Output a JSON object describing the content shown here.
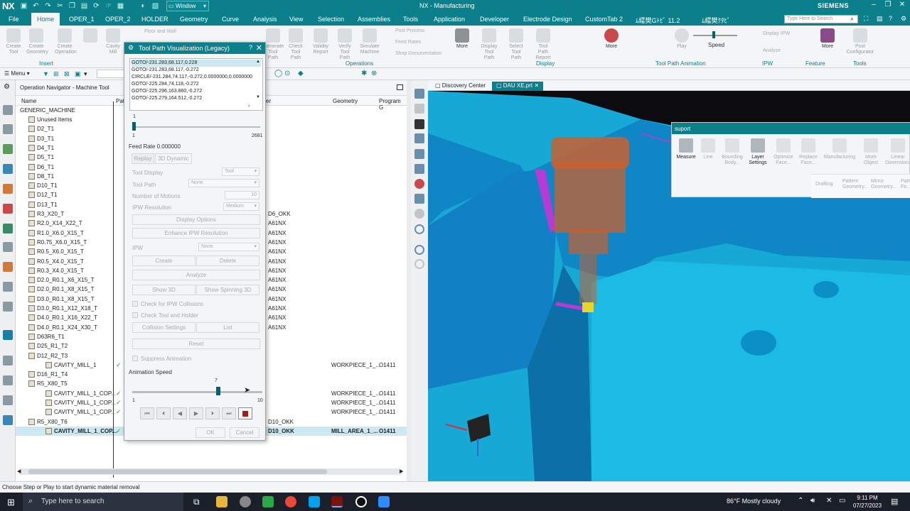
{
  "titlebar": {
    "logo": "NX",
    "window_menu": "Window",
    "app_title": "NX - Manufacturing",
    "brand": "SIEMENS"
  },
  "menubar": {
    "items": [
      "File",
      "Home",
      "OPER_1",
      "OPER_2",
      "HOLDER",
      "Geometry",
      "Curve",
      "Analysis",
      "View",
      "Selection",
      "Assemblies",
      "Tools",
      "Application",
      "Developer",
      "Electrode Design",
      "CustomTab 2",
      "ﾑ繧樊Gﾄﾋﾟ 11.2",
      "ﾑ繧樊ｸﾀﾋﾟ"
    ],
    "active": "Home",
    "search_placeholder": "Type Here to Search"
  },
  "ribbon": {
    "buttons": [
      "Create Tool",
      "Create Geometry",
      "Create Operation",
      "Cavity Mill",
      "Floor and Wall",
      "Generate Tool Path",
      "Check Tool Path",
      "Validity Report",
      "Verify Tool Path",
      "Simulate Machine",
      "Post Process",
      "Feed Rates",
      "Shop Documentation",
      "More",
      "Display Tool Path",
      "Select Tool Path",
      "Tool Path Report",
      "More",
      "Play",
      "Speed",
      "Display IPW",
      "Analyze",
      "More",
      "Post Configurator"
    ],
    "groups": [
      "Insert",
      "Operations",
      "Display",
      "Tool Path Animation",
      "IPW",
      "Feature",
      "Tools"
    ]
  },
  "toolbar2": {
    "menu_label": "Menu"
  },
  "navigator": {
    "title": "Operation Navigator - Machine Tool",
    "columns": [
      "Name",
      "Pat",
      "er",
      "Geometry",
      "Program G"
    ],
    "root": "GENERIC_MACHINE",
    "rows": [
      {
        "name": "Unused Items",
        "path": "",
        "geo": "",
        "prog": ""
      },
      {
        "name": "D2_T1",
        "path": "",
        "geo": "",
        "prog": ""
      },
      {
        "name": "D3_T1",
        "path": "",
        "geo": "",
        "prog": ""
      },
      {
        "name": "D4_T1",
        "path": "",
        "geo": "",
        "prog": ""
      },
      {
        "name": "D5_T1",
        "path": "",
        "geo": "",
        "prog": ""
      },
      {
        "name": "D6_T1",
        "path": "",
        "geo": "",
        "prog": ""
      },
      {
        "name": "D8_T1",
        "path": "",
        "geo": "",
        "prog": ""
      },
      {
        "name": "D10_T1",
        "path": "",
        "geo": "",
        "prog": ""
      },
      {
        "name": "D12_T1",
        "path": "",
        "geo": "",
        "prog": ""
      },
      {
        "name": "D13_T1",
        "path": "",
        "geo": "",
        "prog": ""
      },
      {
        "name": "R3_X20_T",
        "path": "D6_OKK",
        "geo": "",
        "prog": ""
      },
      {
        "name": "R2.0_X14_X22_T",
        "path": "A61NX",
        "geo": "",
        "prog": ""
      },
      {
        "name": "R1.0_X6.0_X15_T",
        "path": "A61NX",
        "geo": "",
        "prog": ""
      },
      {
        "name": "R0.75_X6.0_X15_T",
        "path": "A61NX",
        "geo": "",
        "prog": ""
      },
      {
        "name": "R0.5_X6.0_X15_T",
        "path": "A61NX",
        "geo": "",
        "prog": ""
      },
      {
        "name": "R0.5_X4.0_X15_T",
        "path": "A61NX",
        "geo": "",
        "prog": ""
      },
      {
        "name": "R0.3_X4.0_X15_T",
        "path": "A61NX",
        "geo": "",
        "prog": ""
      },
      {
        "name": "D2.0_R0.1_X6_X15_T",
        "path": "A61NX",
        "geo": "",
        "prog": ""
      },
      {
        "name": "D2.0_R0.1_X8_X15_T",
        "path": "A61NX",
        "geo": "",
        "prog": ""
      },
      {
        "name": "D3.0_R0.1_X8_X15_T",
        "path": "A61NX",
        "geo": "",
        "prog": ""
      },
      {
        "name": "D3.0_R0.1_X12_X18_T",
        "path": "A61NX",
        "geo": "",
        "prog": ""
      },
      {
        "name": "D4.0_R0.1_X16_X22_T",
        "path": "A61NX",
        "geo": "",
        "prog": ""
      },
      {
        "name": "D4.0_R0.1_X24_X30_T",
        "path": "A61NX",
        "geo": "",
        "prog": ""
      },
      {
        "name": "D63R6_T1",
        "path": "",
        "geo": "",
        "prog": ""
      },
      {
        "name": "D25_R1_T2",
        "path": "",
        "geo": "",
        "prog": ""
      },
      {
        "name": "D12_R2_T3",
        "path": "",
        "geo": "",
        "prog": ""
      },
      {
        "name": "CAVITY_MILL_1",
        "path": "",
        "geo": "WORKPIECE_1_...",
        "prog": "O1411"
      },
      {
        "name": "D16_R1_T4",
        "path": "",
        "geo": "",
        "prog": ""
      },
      {
        "name": "R5_X80_T5",
        "path": "",
        "geo": "",
        "prog": ""
      },
      {
        "name": "CAVITY_MILL_1_COP...",
        "path": "",
        "geo": "WORKPIECE_1_...",
        "prog": "O1411"
      },
      {
        "name": "CAVITY_MILL_1_COP...",
        "path": "",
        "geo": "WORKPIECE_1_...",
        "prog": "O1411"
      },
      {
        "name": "CAVITY_MILL_1_COP...",
        "path": "",
        "geo": "WORKPIECE_1_...",
        "prog": "O1411"
      },
      {
        "name": "R5_X80_T6",
        "path": "D10_OKK",
        "geo": "",
        "prog": ""
      },
      {
        "name": "CAVITY_MILL_1_COP...",
        "path": "D10_OKK",
        "geo": "MILL_AREA_1_...",
        "prog": "O1411"
      }
    ]
  },
  "dialog": {
    "title": "Tool Path Visualization (Legacy)",
    "help": "?",
    "close": "X",
    "motions": [
      "GOTO/-231.283,68.117,0.228",
      "GOTO/-231.283,68.117,-0.272",
      "CIRCLE/-231.284,74.117,-0.272,0.0000000,0.0000000",
      "GOTO/-225.284,74.118,-0.272",
      "GOTO/-225.296,163.860,-0.272",
      "GOTO/-225.279,164.512,-0.272"
    ],
    "slider_current": "1",
    "slider_min": "1",
    "slider_max": "2681",
    "feed_rate": "Feed Rate 0.000000",
    "tabs": [
      "Replay",
      "3D Dynamic"
    ],
    "tool_display_label": "Tool Display",
    "tool_display_value": "Tool",
    "tool_path_label": "Tool Path",
    "tool_path_value": "None",
    "num_motions_label": "Number of Motions",
    "num_motions_value": "10",
    "ipw_res_label": "IPW Resolution",
    "ipw_res_value": "Medium",
    "display_options": "Display Options",
    "enhance_ipw": "Enhance IPW Resolution",
    "ipw_label": "IPW",
    "ipw_value": "None",
    "create": "Create",
    "delete": "Delete",
    "analyze": "Analyze",
    "show3d": "Show 3D",
    "show_spinning": "Show Spinning 3D",
    "check_ipw": "Check for IPW Collisions",
    "check_tool_holder": "Check Tool and Holder",
    "collision_settings": "Collision Settings",
    "list": "List",
    "reset": "Reset",
    "suppress_animation": "Suppress Animation",
    "anim_speed_label": "Animation Speed",
    "anim_speed_value": "7",
    "anim_speed_fraction": 0.667,
    "anim_min": "1",
    "anim_max": "10",
    "ok": "OK",
    "cancel": "Cancel"
  },
  "viewport": {
    "tabs": [
      "Discovery Center",
      "DAU XE.prt"
    ],
    "active_tab": "DAU XE.prt"
  },
  "suport_panel": {
    "title": "suport",
    "buttons": [
      "Measure",
      "Line",
      "Bounding Body...",
      "Layer Settings",
      "Optimize Face...",
      "Replace Face...",
      "Manufacturing",
      "More Object",
      "Linear Dimension..."
    ],
    "buttons_row2": [
      "Drafting",
      "Pattern Geometry...",
      "Mirror Geometry...",
      "Pattern Fe..."
    ]
  },
  "statusbar": {
    "message": "Choose Step or Play to start dynamic material removal"
  },
  "taskbar": {
    "search_placeholder": "Type here to search",
    "weather": "86°F  Mostly cloudy",
    "time": "9:11 PM",
    "date": "07/27/2023"
  }
}
